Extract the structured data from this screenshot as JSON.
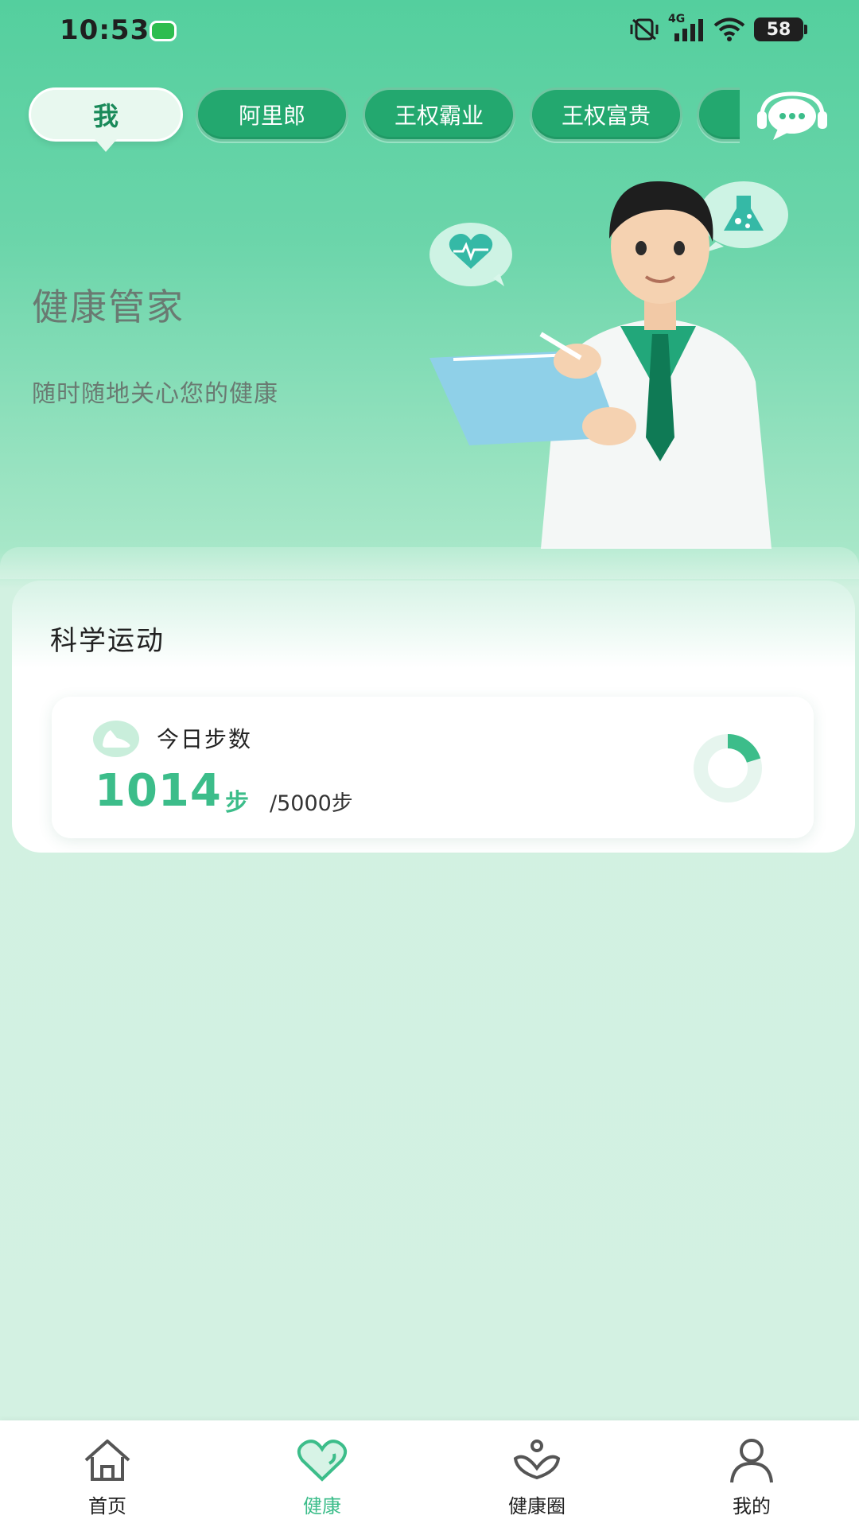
{
  "status_bar": {
    "time": "10:53",
    "network": "4G",
    "battery": "58",
    "icons": [
      "message-icon",
      "mute-vibrate-icon",
      "signal-icon",
      "wifi-icon",
      "battery-icon"
    ]
  },
  "member_tabs": [
    {
      "label": "我",
      "active": true
    },
    {
      "label": "阿里郎",
      "active": false
    },
    {
      "label": "王权霸业",
      "active": false
    },
    {
      "label": "王权富贵",
      "active": false
    },
    {
      "label": "",
      "active": false
    }
  ],
  "hero": {
    "title": "健康管家",
    "subtitle": "随时随地关心您的健康"
  },
  "exercise": {
    "title": "科学运动",
    "steps_label": "今日步数",
    "steps_value": "1014",
    "steps_unit": "步",
    "steps_goal": "/5000步",
    "progress": 0.2028
  },
  "bottom_nav": [
    {
      "label": "首页",
      "icon": "home-icon",
      "active": false
    },
    {
      "label": "健康",
      "icon": "heart-icon",
      "active": true
    },
    {
      "label": "健康圈",
      "icon": "community-icon",
      "active": false
    },
    {
      "label": "我的",
      "icon": "user-icon",
      "active": false
    }
  ],
  "colors": {
    "accent": "#3cbd8a",
    "tab_bg": "#23a86f",
    "header_top": "#54cf9e",
    "page_bg": "#d3f1e2"
  }
}
